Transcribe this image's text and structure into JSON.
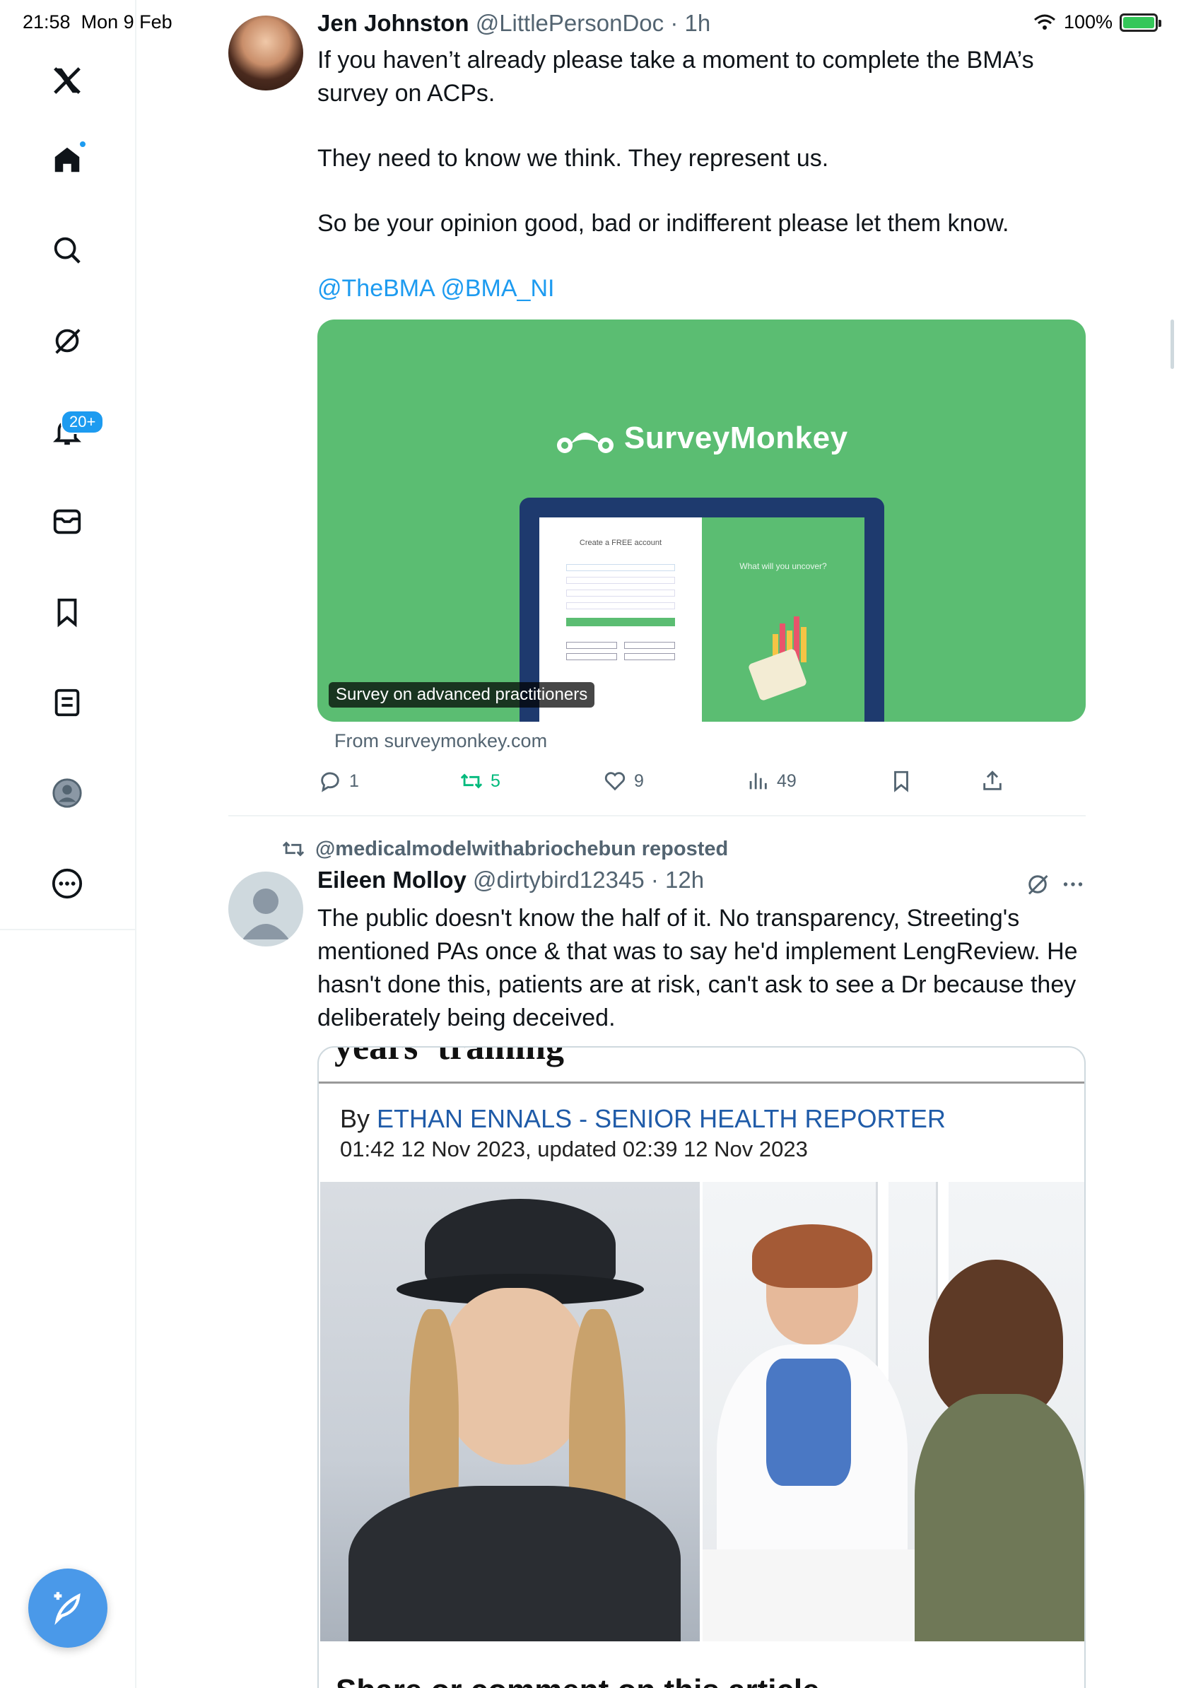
{
  "status": {
    "time": "21:58",
    "date": "Mon 9 Feb",
    "battery": "100%"
  },
  "sidebar": {
    "notifications_badge": "20+"
  },
  "tweet1": {
    "name": "Jen Johnston",
    "handle": "@LittlePersonDoc",
    "time": "1h",
    "text_p1": "If you haven’t already please take a moment to complete the BMA’s survey on ACPs.",
    "text_p2": "They need to know we think. They represent us.",
    "text_p3": "So be your opinion good, bad or indifferent please let them know.",
    "mentions": "@TheBMA @BMA_NI",
    "card": {
      "brand": "SurveyMonkey",
      "screen_heading": "Create a FREE account",
      "screen_right": "What will you uncover?",
      "caption": "Survey on advanced practitioners",
      "source": "From surveymonkey.com"
    },
    "stats": {
      "replies": "1",
      "reposts": "5",
      "likes": "9",
      "views": "49"
    }
  },
  "tweet2": {
    "repost_label": "@medicalmodelwithabriochebun reposted",
    "name": "Eileen Molloy",
    "handle": "@dirtybird12345",
    "time": "12h",
    "text": "The public doesn't know the half of it. No transparency, Streeting's mentioned PAs once & that was to say he'd implement LengReview. He hasn't done this, patients are at risk, can't ask to see a Dr because they deliberately being deceived.",
    "article": {
      "clipped_headline": "years' training",
      "by": "By",
      "author": "ETHAN ENNALS - SENIOR HEALTH REPORTER",
      "dateline": "01:42 12 Nov 2023, updated 02:39 12 Nov 2023",
      "bottom_clipped": "Share or comment on this article"
    }
  },
  "colors": {
    "accent": "#1d9bf0",
    "surveymonkey_green": "#5bbd72",
    "retweet_green": "#00ba7c"
  }
}
